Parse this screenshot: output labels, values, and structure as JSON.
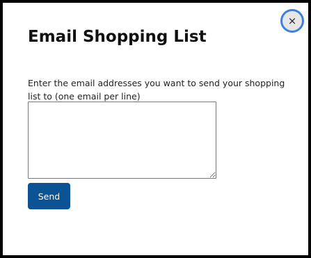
{
  "dialog": {
    "title": "Email Shopping List",
    "close_label": "×",
    "instructions": "Enter the email addresses you want to send your shopping list to (one email per line)",
    "email_field_value": "",
    "send_label": "Send"
  },
  "colors": {
    "accent": "#0b5394",
    "focus_ring": "#3b82e0",
    "background": "#ffffff",
    "frame": "#000000"
  },
  "icons": {
    "close": "close-icon"
  }
}
